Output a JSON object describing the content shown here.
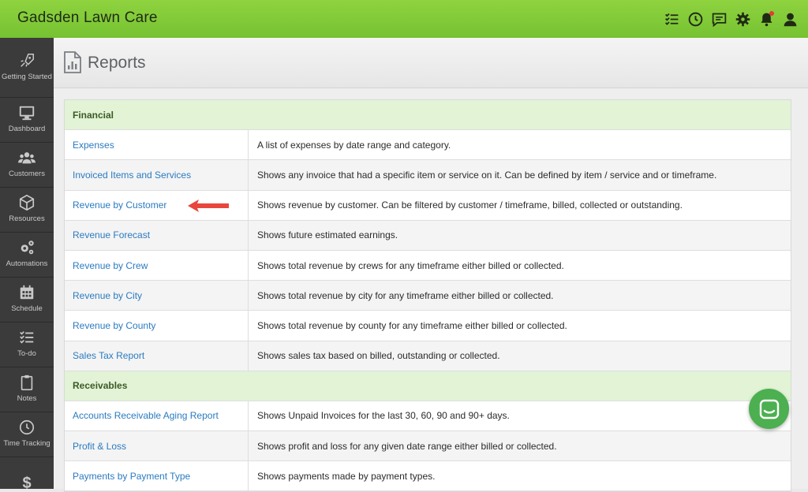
{
  "app": {
    "title": "Gadsden Lawn Care"
  },
  "topbar_icons": [
    "checklist-icon",
    "clock-icon",
    "chat-icon",
    "gear-icon",
    "bell-icon",
    "user-icon"
  ],
  "sidebar": {
    "items": [
      {
        "label": "Getting Started",
        "icon": "rocket-icon"
      },
      {
        "label": "Dashboard",
        "icon": "monitor-icon"
      },
      {
        "label": "Customers",
        "icon": "users-icon"
      },
      {
        "label": "Resources",
        "icon": "box-icon"
      },
      {
        "label": "Automations",
        "icon": "gears-icon"
      },
      {
        "label": "Schedule",
        "icon": "calendar-icon"
      },
      {
        "label": "To-do",
        "icon": "todo-icon"
      },
      {
        "label": "Notes",
        "icon": "clipboard-icon"
      },
      {
        "label": "Time Tracking",
        "icon": "clock-icon"
      },
      {
        "label": "$",
        "icon": "dollar-icon"
      }
    ]
  },
  "page": {
    "title": "Reports"
  },
  "sections": [
    {
      "title": "Financial",
      "rows": [
        {
          "name": "Expenses",
          "desc": "A list of expenses by date range and category."
        },
        {
          "name": "Invoiced Items and Services",
          "desc": "Shows any invoice that had a specific item or service on it. Can be defined by item / service and or timeframe."
        },
        {
          "name": "Revenue by Customer",
          "desc": "Shows revenue by customer. Can be filtered by customer / timeframe, billed, collected or outstanding."
        },
        {
          "name": "Revenue Forecast",
          "desc": "Shows future estimated earnings."
        },
        {
          "name": "Revenue by Crew",
          "desc": "Shows total revenue by crews for any timeframe either billed or collected."
        },
        {
          "name": "Revenue by City",
          "desc": "Shows total revenue by city for any timeframe either billed or collected."
        },
        {
          "name": "Revenue by County",
          "desc": "Shows total revenue by county for any timeframe either billed or collected."
        },
        {
          "name": "Sales Tax Report",
          "desc": "Shows sales tax based on billed, outstanding or collected."
        }
      ]
    },
    {
      "title": "Receivables",
      "rows": [
        {
          "name": "Accounts Receivable Aging Report",
          "desc": "Shows Unpaid Invoices for the last 30, 60, 90 and 90+ days."
        },
        {
          "name": "Profit & Loss",
          "desc": "Shows profit and loss for any given date range either billed or collected."
        },
        {
          "name": "Payments by Payment Type",
          "desc": "Shows payments made by payment types."
        }
      ]
    }
  ],
  "colors": {
    "topbar": "#80c93a",
    "sidebar": "#3b3b3b",
    "link": "#2a7bc0",
    "section_bg": "#e2f3d6",
    "arrow": "#e8463d",
    "chat": "#4caf50"
  }
}
